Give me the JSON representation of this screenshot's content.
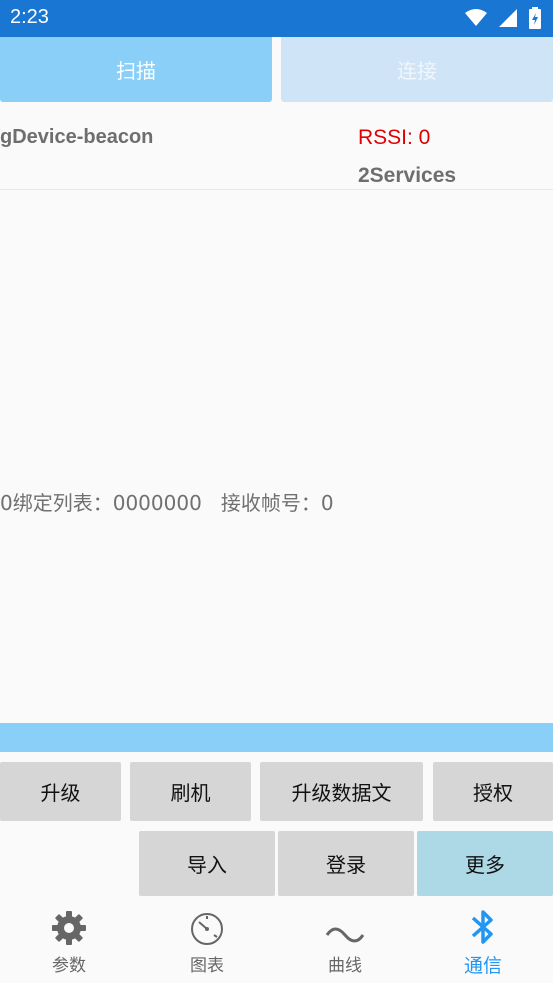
{
  "status_bar": {
    "time": "2:23"
  },
  "top_buttons": {
    "scan": "扫描",
    "connect": "连接"
  },
  "device": {
    "name": "gDevice-beacon",
    "rssi": "RSSI: 0",
    "services": "2Services"
  },
  "bind_info": "0绑定列表：0000000   接收帧号：0",
  "actions": {
    "upgrade": "升级",
    "flash": "刷机",
    "upgrade_data_file": "升级数据文",
    "authorize": "授权",
    "import": "导入",
    "login": "登录",
    "more": "更多"
  },
  "bottom_nav": [
    {
      "label": "参数",
      "icon": "gear-icon"
    },
    {
      "label": "图表",
      "icon": "gauge-icon"
    },
    {
      "label": "曲线",
      "icon": "wave-icon"
    },
    {
      "label": "通信",
      "icon": "bluetooth-icon",
      "active": true
    }
  ],
  "colors": {
    "status_bar": "#1976d2",
    "accent_blue": "#89cff8",
    "rssi_red": "#e00000",
    "active_tab": "#2196f3",
    "more_button": "#add8e6"
  }
}
